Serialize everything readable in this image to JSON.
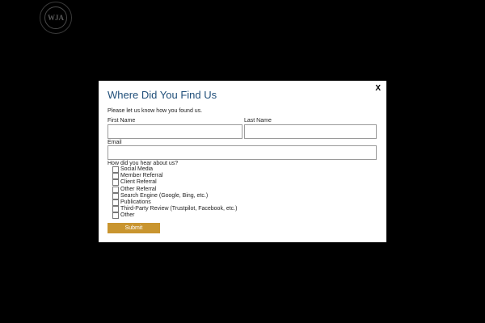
{
  "logo": {
    "text": "WJA"
  },
  "modal": {
    "close_label": "X",
    "title": "Where Did You Find Us",
    "intro": "Please let us know how you found us.",
    "first_name_label": "First Name",
    "first_name_value": "",
    "last_name_label": "Last Name",
    "last_name_value": "",
    "email_label": "Email",
    "email_value": "",
    "question": "How did you hear about us?",
    "options": [
      {
        "label": "Social Media",
        "checked": false
      },
      {
        "label": "Member Referral",
        "checked": false
      },
      {
        "label": "Client Referral",
        "checked": false
      },
      {
        "label": "Other Referral",
        "checked": false
      },
      {
        "label": "Search Engine (Google, Bing, etc.)",
        "checked": false
      },
      {
        "label": "Publications",
        "checked": false
      },
      {
        "label": "Third-Party Review (Trustpilot, Facebook, etc.)",
        "checked": false
      },
      {
        "label": "Other",
        "checked": false
      }
    ],
    "submit_label": "Submit"
  },
  "colors": {
    "backdrop": "#000000",
    "title": "#1f4e79",
    "submit_button": "#c9952f"
  }
}
